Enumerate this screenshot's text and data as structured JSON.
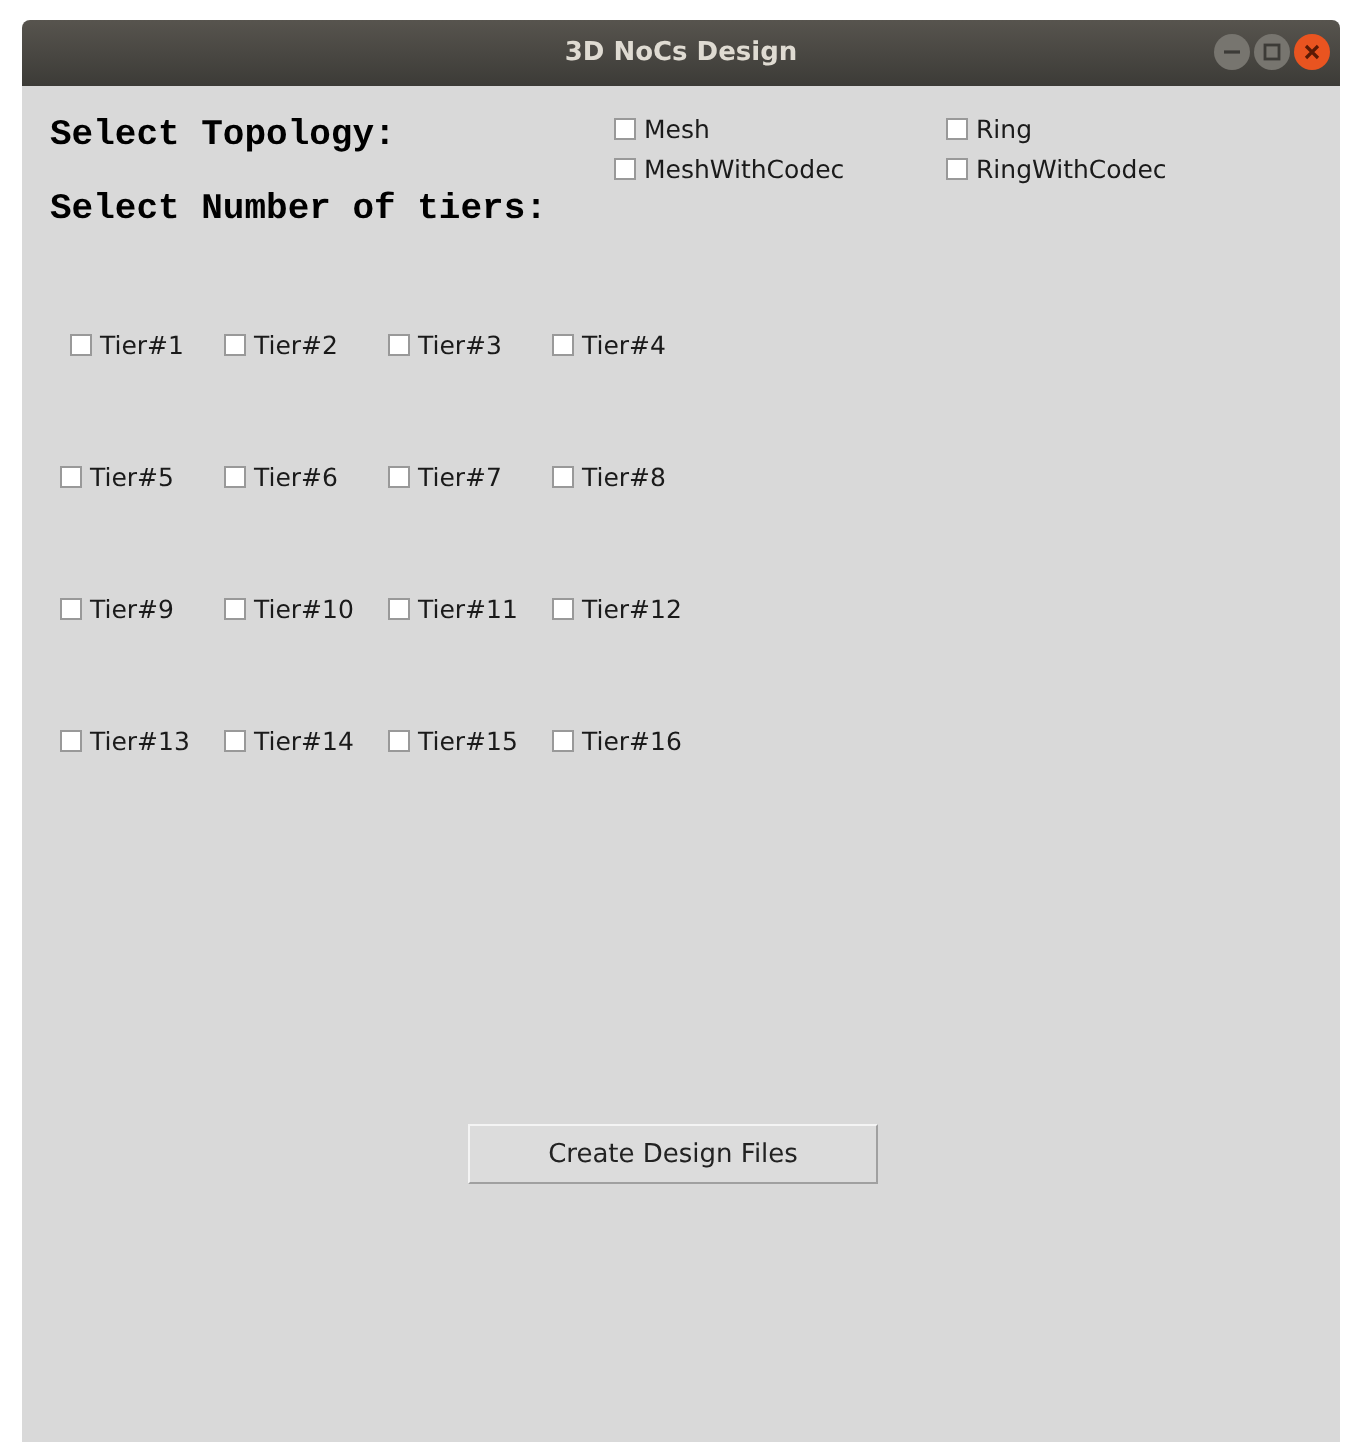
{
  "window": {
    "title": "3D NoCs Design"
  },
  "topology": {
    "label": "Select Topology:",
    "options": [
      {
        "label": "Mesh",
        "checked": false
      },
      {
        "label": "Ring",
        "checked": false
      },
      {
        "label": "MeshWithCodec",
        "checked": false
      },
      {
        "label": "RingWithCodec",
        "checked": false
      }
    ]
  },
  "tiers": {
    "label": "Select Number of tiers:",
    "options": [
      {
        "label": "Tier#1",
        "checked": false
      },
      {
        "label": "Tier#2",
        "checked": false
      },
      {
        "label": "Tier#3",
        "checked": false
      },
      {
        "label": "Tier#4",
        "checked": false
      },
      {
        "label": "Tier#5",
        "checked": false
      },
      {
        "label": "Tier#6",
        "checked": false
      },
      {
        "label": "Tier#7",
        "checked": false
      },
      {
        "label": "Tier#8",
        "checked": false
      },
      {
        "label": "Tier#9",
        "checked": false
      },
      {
        "label": "Tier#10",
        "checked": false
      },
      {
        "label": "Tier#11",
        "checked": false
      },
      {
        "label": "Tier#12",
        "checked": false
      },
      {
        "label": "Tier#13",
        "checked": false
      },
      {
        "label": "Tier#14",
        "checked": false
      },
      {
        "label": "Tier#15",
        "checked": false
      },
      {
        "label": "Tier#16",
        "checked": false
      }
    ]
  },
  "button": {
    "label": "Create Design Files"
  }
}
